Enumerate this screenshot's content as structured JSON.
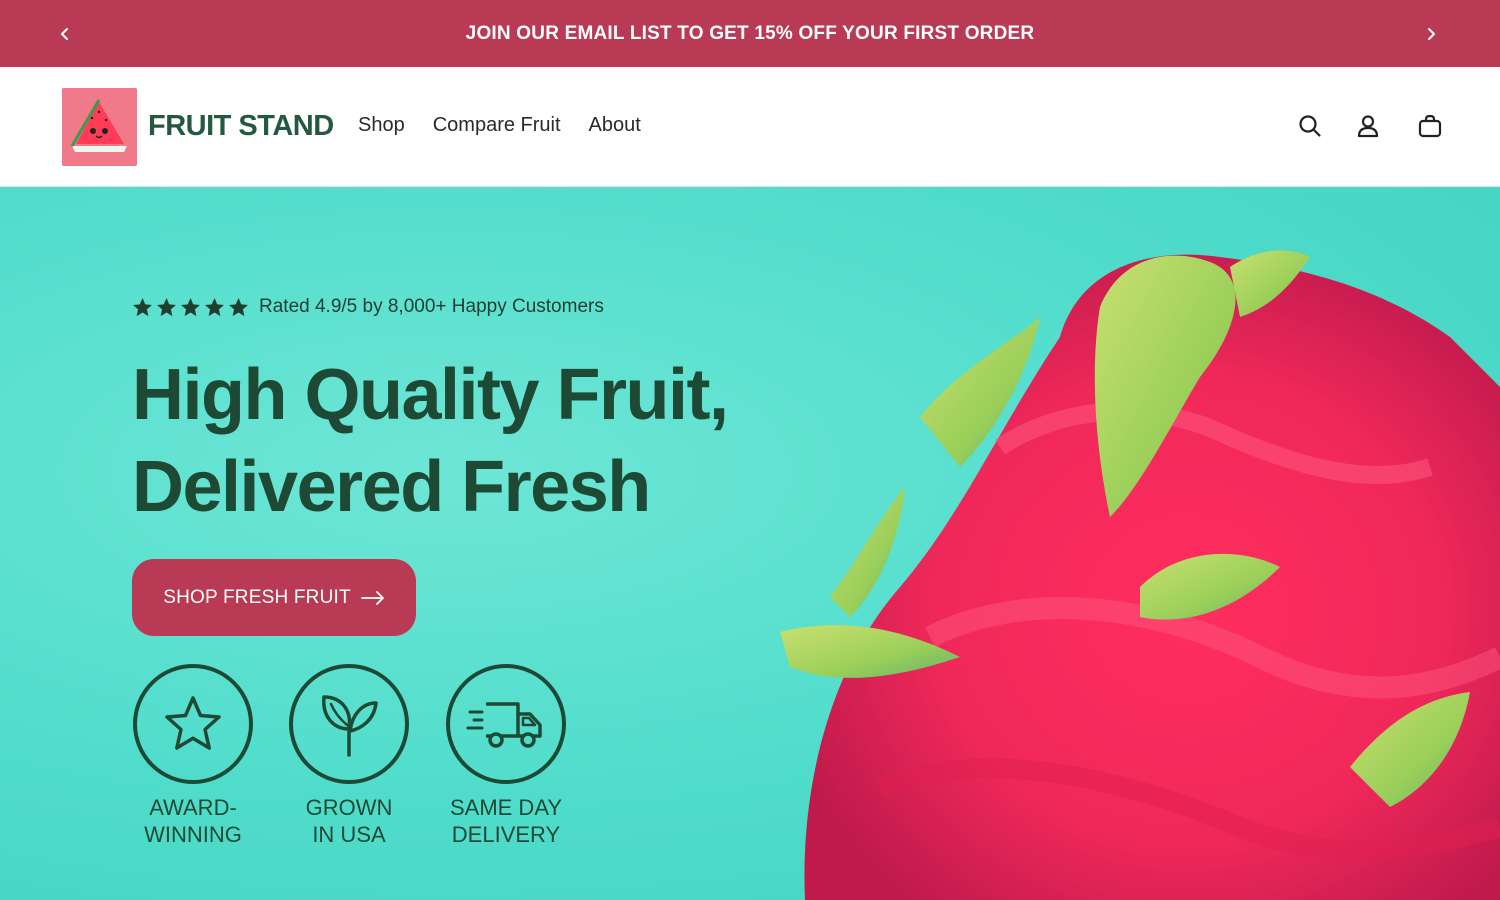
{
  "announcement": {
    "text": "JOIN OUR EMAIL LIST TO GET 15% OFF YOUR FIRST ORDER",
    "bg_color": "#b93a55"
  },
  "header": {
    "brand": "FRUIT STAND",
    "brand_color": "#24593f",
    "nav": [
      "Shop",
      "Compare Fruit",
      "About"
    ],
    "icons": [
      "search-icon",
      "account-icon",
      "cart-icon"
    ]
  },
  "hero": {
    "rating_stars": 5,
    "rating_text": "Rated 4.9/5 by 8,000+ Happy Customers",
    "headline_line1": "High Quality Fruit,",
    "headline_line2": "Delivered Fresh",
    "cta_label": "SHOP FRESH FRUIT",
    "cta_color": "#b93a55",
    "background_color": "#4fdccb",
    "features": [
      {
        "icon": "star-icon",
        "line1": "AWARD-",
        "line2": "WINNING"
      },
      {
        "icon": "sprout-icon",
        "line1": "GROWN",
        "line2": "IN USA"
      },
      {
        "icon": "truck-icon",
        "line1": "SAME DAY",
        "line2": "DELIVERY"
      }
    ]
  }
}
